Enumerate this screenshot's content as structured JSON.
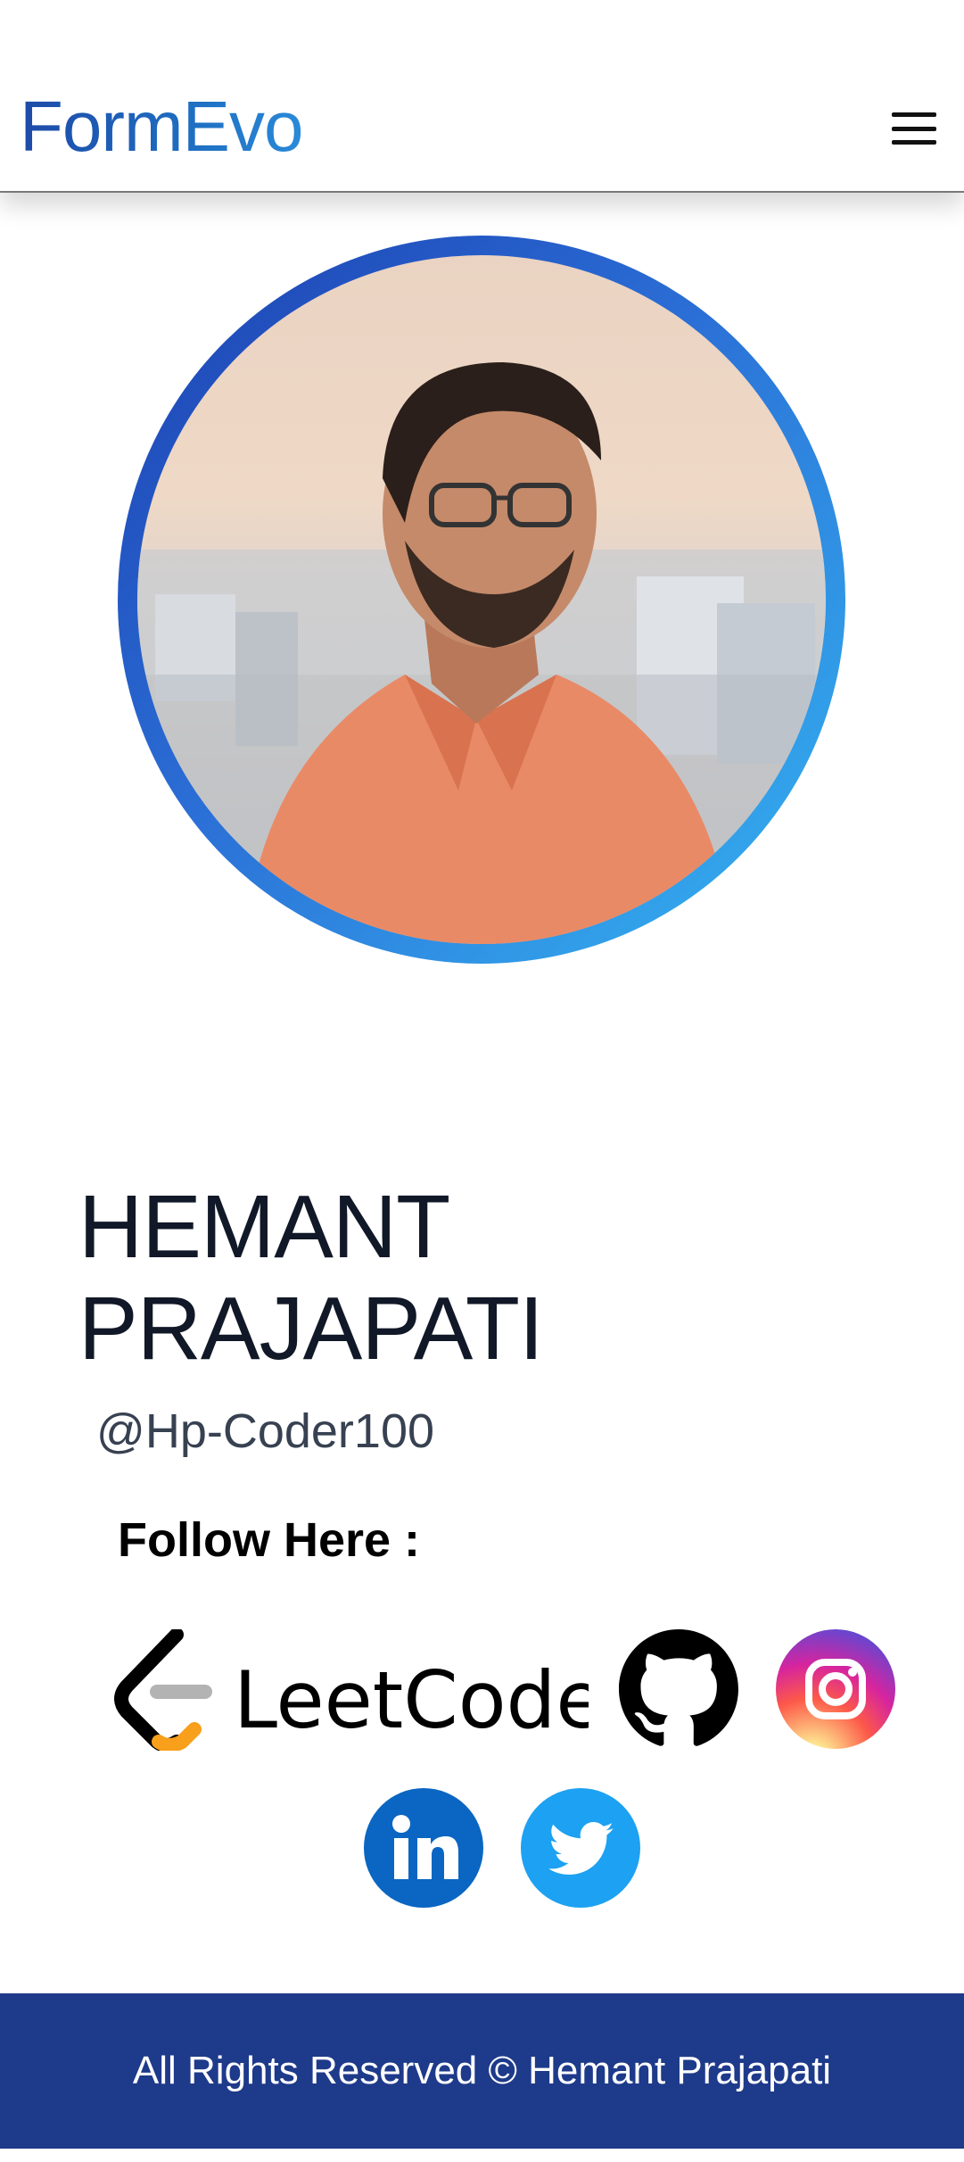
{
  "header": {
    "brand": "FormEvo",
    "menu_icon": "hamburger-menu-icon"
  },
  "profile": {
    "name_line1": "HEMANT",
    "name_line2": "PRAJAPATI",
    "handle": "@Hp-Coder100",
    "photo_alt": "Profile photo"
  },
  "follow": {
    "label": "Follow Here :",
    "links": [
      {
        "name": "leetcode",
        "wordmark": "LeetCode",
        "icon": "leetcode-logo-icon"
      },
      {
        "name": "github",
        "icon": "github-icon"
      },
      {
        "name": "instagram",
        "icon": "instagram-icon"
      },
      {
        "name": "linkedin",
        "icon": "linkedin-icon"
      },
      {
        "name": "twitter",
        "icon": "twitter-icon"
      }
    ]
  },
  "footer": {
    "text": "All Rights Reserved © Hemant Prajapati"
  },
  "colors": {
    "brand_blue": "#1e4aa8",
    "footer_bg": "#1e3a8a",
    "ring_start": "#1c3fb0",
    "ring_end": "#35b6f2",
    "linkedin": "#0a66c2",
    "twitter": "#1da1f2"
  }
}
